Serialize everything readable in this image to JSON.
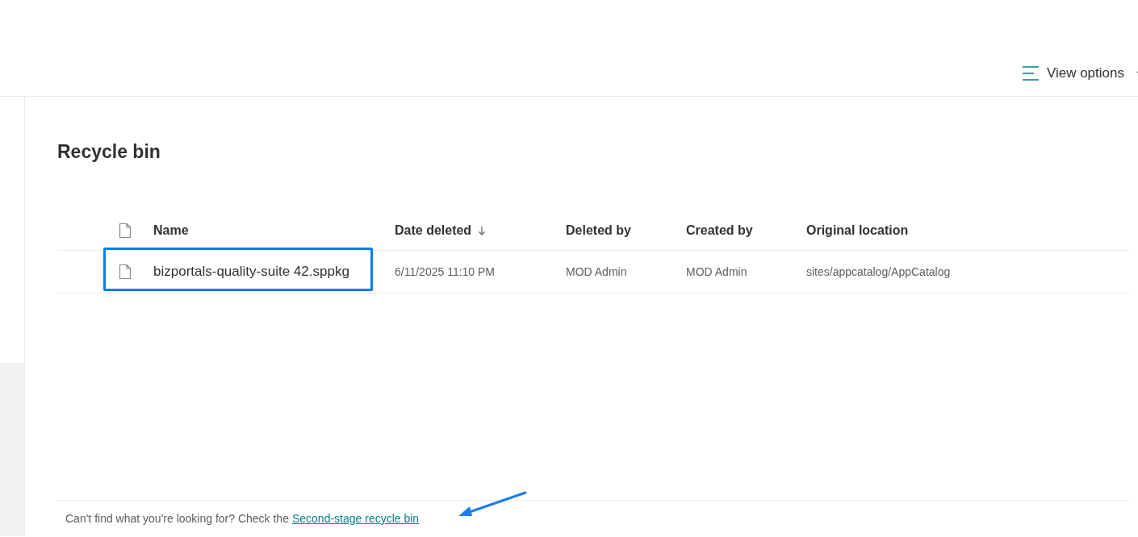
{
  "toolbar": {
    "view_options": "View options"
  },
  "title": "Recycle bin",
  "table": {
    "columns": [
      {
        "label": "Name",
        "sorted": false
      },
      {
        "label": "Date deleted",
        "sorted": true
      },
      {
        "label": "Deleted by",
        "sorted": false
      },
      {
        "label": "Created by",
        "sorted": false
      },
      {
        "label": "Original location",
        "sorted": false
      }
    ],
    "rows": [
      {
        "name": "bizportals-quality-suite 42.sppkg",
        "date_deleted": "6/11/2025 11:10 PM",
        "deleted_by": "MOD Admin",
        "created_by": "MOD Admin",
        "original_location": "sites/appcatalog/AppCatalog",
        "highlighted": true
      }
    ]
  },
  "footer": {
    "text": "Can't find what you're looking for? Check the",
    "link": "Second-stage recycle bin"
  }
}
